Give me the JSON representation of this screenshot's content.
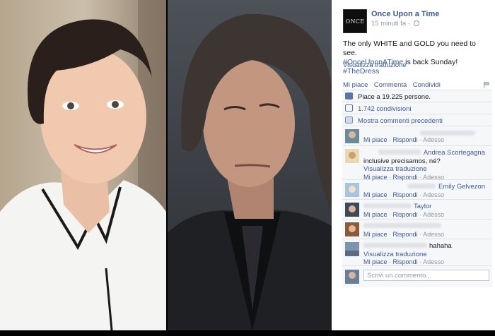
{
  "post": {
    "page_name": "Once Upon a Time",
    "logo_text": "ONCE",
    "time": "15 minuti fa",
    "privacy_icon": "globe-icon",
    "text_line1": "The only WHITE and GOLD you need to see.",
    "hashtag1": "#OnceUponATime",
    "text_middle": " is back Sunday! ",
    "hashtag2": "#TheDress",
    "see_translation": "Visualizza traduzione"
  },
  "actions": {
    "like": "Mi piace",
    "comment": "Commenta",
    "share": "Condividi",
    "separator": "·"
  },
  "ufi": {
    "likes": "Piace a 19.225 persone.",
    "shares": "1.742 condivisioni",
    "previous_comments": "Mostra commenti precedenti"
  },
  "comment_actions": {
    "like": "Mi piace",
    "reply": "Rispondi",
    "time": "Adesso"
  },
  "comments": [
    {
      "author": "",
      "text": "",
      "translation": ""
    },
    {
      "author": "Andrea Scortegagna",
      "text": "inclusive precisamos, né?",
      "translation": "Visualizza traduzione"
    },
    {
      "author": "Emily Gelvezon",
      "text": "",
      "translation": ""
    },
    {
      "author": "Taylor",
      "text": "",
      "translation": ""
    },
    {
      "author": "",
      "text": "",
      "translation": ""
    },
    {
      "author": "",
      "text": "hahaha",
      "translation": "Visualizza traduzione"
    }
  ],
  "composer": {
    "placeholder": "Scrivi un commento..."
  },
  "colors": {
    "link": "#3b5998",
    "muted": "#9197a3",
    "ufi_bg": "#f6f7f9",
    "border": "#e1e2e3"
  }
}
